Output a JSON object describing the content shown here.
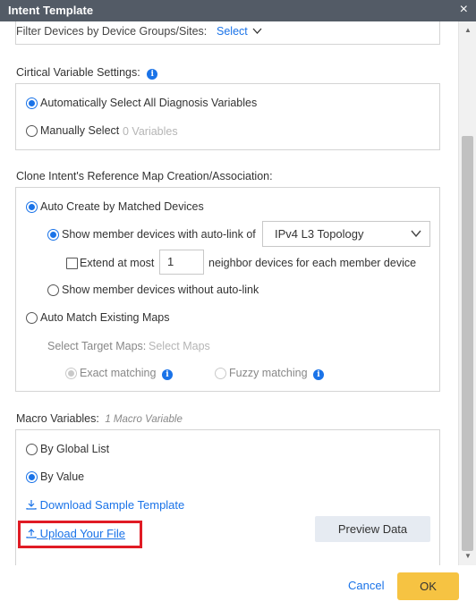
{
  "window": {
    "title": "Intent Template",
    "close_icon": "×"
  },
  "filter": {
    "label": "Filter Devices by Device Groups/Sites:",
    "select_link": "Select"
  },
  "critical": {
    "heading": "Cirtical Variable Settings:",
    "opt_auto": "Automatically Select All Diagnosis Variables",
    "opt_manual": "Manually Select",
    "manual_count": "0 Variables"
  },
  "clone": {
    "heading": "Clone Intent's Reference Map Creation/Association:",
    "auto_create": "Auto Create by Matched Devices",
    "show_autolink": "Show member devices with auto-link of",
    "topology_value": "IPv4 L3 Topology",
    "extend_label": "Extend at most",
    "extend_value": "1",
    "neighbor_label": "neighbor devices for each member device",
    "show_no_autolink": "Show member devices without auto-link",
    "auto_match": "Auto Match Existing Maps",
    "target_maps_label": "Select Target Maps:",
    "target_maps_placeholder": "Select Maps",
    "exact_matching": "Exact matching",
    "fuzzy_matching": "Fuzzy matching"
  },
  "macro": {
    "heading": "Macro Variables:",
    "count": "1 Macro Variable",
    "by_global": "By Global List",
    "by_value": "By Value",
    "download": "Download Sample Template",
    "upload": "Upload Your File",
    "preview": "Preview Data"
  },
  "footer": {
    "cancel": "Cancel",
    "ok": "OK"
  },
  "colors": {
    "accent": "#1a73e8",
    "ok_button": "#f6c342",
    "titlebar": "#535b66",
    "highlight": "#e01b24"
  }
}
